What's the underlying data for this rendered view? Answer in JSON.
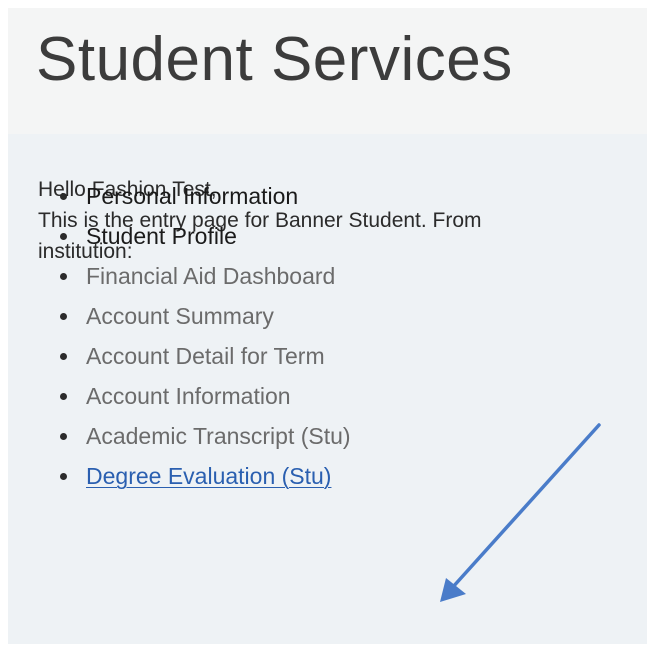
{
  "page": {
    "title": "Student Services"
  },
  "intro": {
    "greeting": "Hello Fashion,Test,",
    "line1": "This is the entry page for Banner Student. From",
    "line2": "institution:"
  },
  "menu": {
    "items": [
      {
        "label": "Personal Information",
        "style": "dark"
      },
      {
        "label": "Student Profile",
        "style": "dark"
      },
      {
        "label": "Financial Aid Dashboard",
        "style": "muted"
      },
      {
        "label": "Account Summary",
        "style": "muted"
      },
      {
        "label": "Account Detail for Term",
        "style": "muted"
      },
      {
        "label": "Account Information",
        "style": "muted"
      },
      {
        "label": "Academic Transcript (Stu)",
        "style": "muted"
      },
      {
        "label": "Degree Evaluation (Stu)",
        "style": "link"
      }
    ]
  },
  "annotation": {
    "arrow_color": "#4a7cc9",
    "icon": "arrow-icon"
  }
}
